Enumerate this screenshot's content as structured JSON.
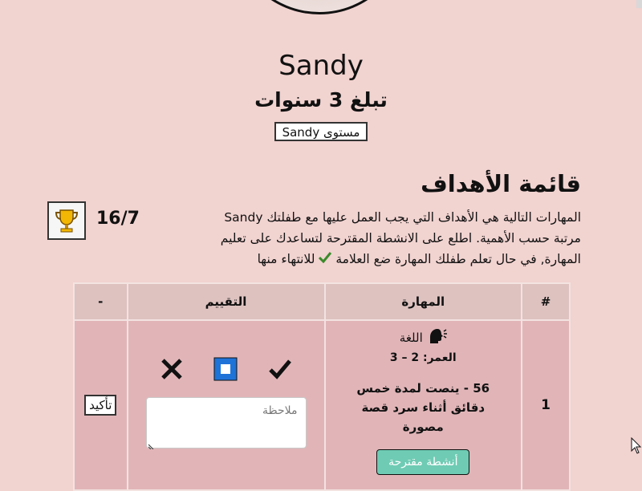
{
  "profile": {
    "name": "Sandy",
    "age_text": "تبلغ 3 سنوات",
    "level_button": "مستوى Sandy"
  },
  "goals": {
    "title": "قائمة الأهداف",
    "description_line1": "المهارات التالية هي الأهداف التي يجب العمل عليها مع طفلتك Sandy",
    "description_line2": "مرتبة حسب الأهمية. اطلع على الانشطة المقترحة لتساعدك على تعليم",
    "description_line3": "المهارة, في حال تعلم طفلك المهارة ضع العلامة",
    "description_line3_end": "للانتهاء منها",
    "score": "16/7"
  },
  "table": {
    "headers": {
      "num": "#",
      "skill": "المهارة",
      "evaluation": "التقييم",
      "action": "-"
    },
    "rows": [
      {
        "num": "1",
        "domain": "اللغة",
        "age": "العمر: 2 – 3",
        "goal": "56 - ينصت لمدة خمس دقائق أثناء سرد قصة مصورة",
        "suggest_button": "أنشطة مقترحة",
        "note_placeholder": "ملاحظة",
        "confirm_button": "تأكيد"
      }
    ]
  },
  "colors": {
    "background": "#f1d3d0",
    "header_cell": "#ddc2c0",
    "row_cell": "#e1b5b8",
    "suggest_button": "#6fcbb4",
    "square_icon": "#1e73d8"
  }
}
